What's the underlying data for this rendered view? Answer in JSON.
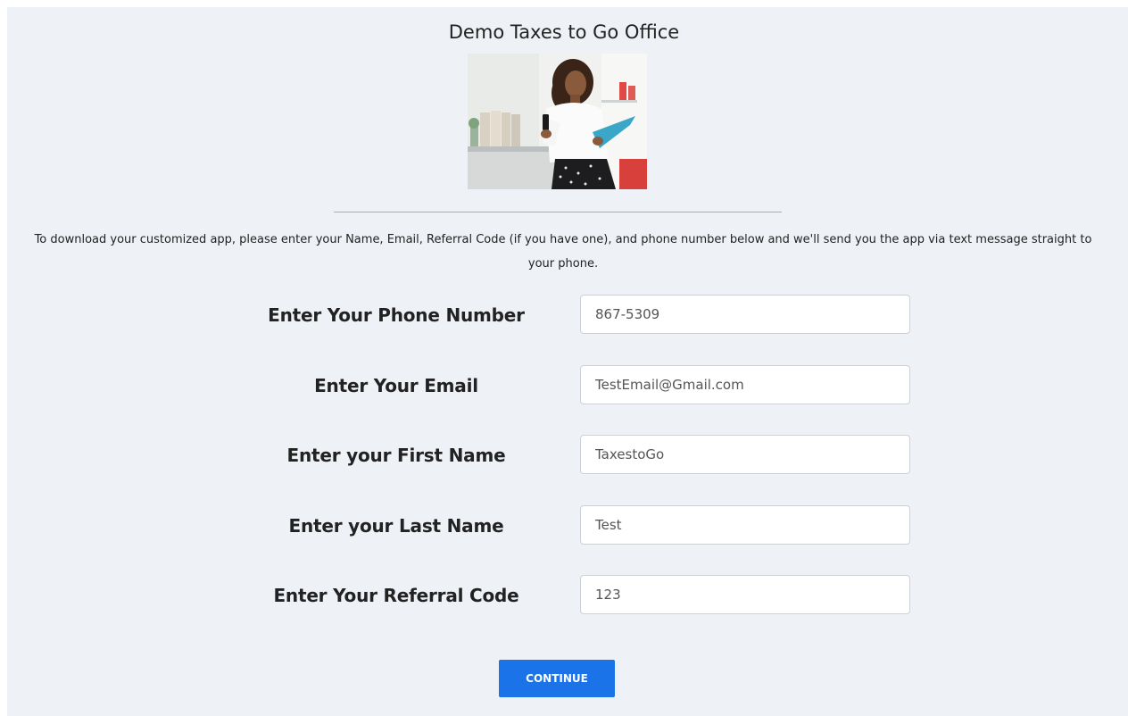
{
  "header": {
    "title": "Demo Taxes to Go Office"
  },
  "hero_image": {
    "icon": "woman-with-phone-photo"
  },
  "intro": {
    "text": "To download your customized app, please enter your Name, Email, Referral Code (if you have one), and phone number below and we'll send you the app via text message straight to your phone."
  },
  "form": {
    "phone": {
      "label": "Enter Your Phone Number",
      "value": "867-5309"
    },
    "email": {
      "label": "Enter Your Email",
      "value": "TestEmail@Gmail.com"
    },
    "first_name": {
      "label": "Enter your First Name",
      "value": "TaxestoGo"
    },
    "last_name": {
      "label": "Enter your Last Name",
      "value": "Test"
    },
    "referral": {
      "label": "Enter Your Referral Code",
      "value": "123"
    }
  },
  "continue_button": {
    "label": "CONTINUE"
  },
  "colors": {
    "page_background": "#eef1f6",
    "button_accent": "#1a73e8"
  }
}
